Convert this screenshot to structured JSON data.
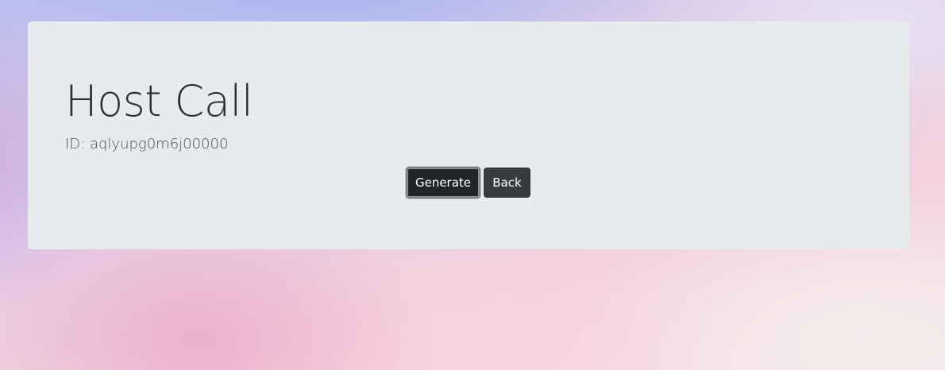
{
  "page": {
    "title": "Host Call",
    "id_label": "ID:",
    "id_value": "aqlyupg0m6j00000"
  },
  "actions": {
    "generate_label": "Generate",
    "back_label": "Back"
  },
  "colors": {
    "panel_background": "#e8ebee",
    "primary_button": "#212529",
    "secondary_button": "#373b40",
    "title_text": "#2b2f33"
  }
}
